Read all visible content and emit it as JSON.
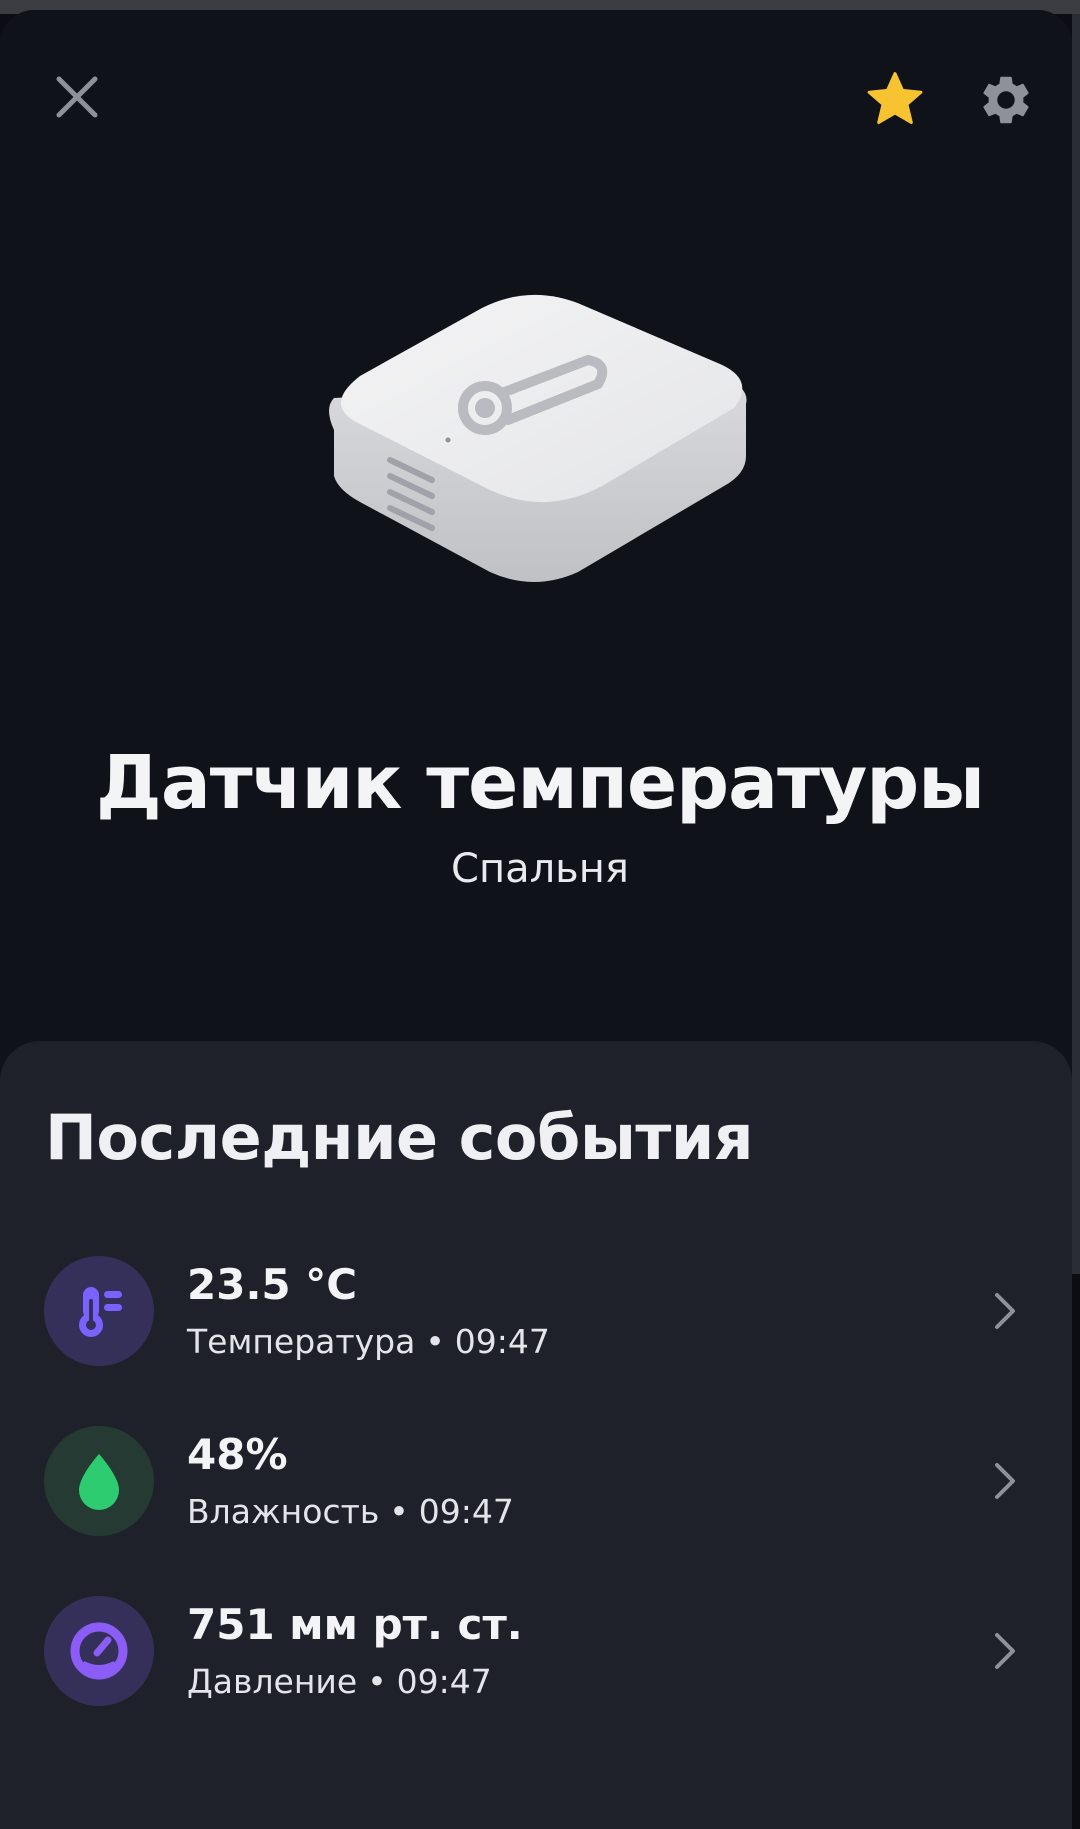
{
  "header": {
    "close_icon": "close-icon",
    "favorite_icon": "star-icon",
    "settings_icon": "gear-icon"
  },
  "device": {
    "image": "temperature-sensor-device",
    "title": "Датчик температуры",
    "room": "Спальня"
  },
  "events": {
    "title": "Последние события",
    "items": [
      {
        "value": "23.5 °C",
        "label": "Температура",
        "time": "09:47",
        "icon": "thermometer-icon",
        "color": "#7b61ff"
      },
      {
        "value": "48%",
        "label": "Влажность",
        "time": "09:47",
        "icon": "water-drop-icon",
        "color": "#2ecc71"
      },
      {
        "value": "751 мм рт. ст.",
        "label": "Давление",
        "time": "09:47",
        "icon": "gauge-icon",
        "color": "#8b5cf6"
      }
    ]
  },
  "colors": {
    "background": "#0f1219",
    "panel": "#1e212a",
    "star": "#f7c331",
    "icon_gray": "#8b8e96"
  }
}
